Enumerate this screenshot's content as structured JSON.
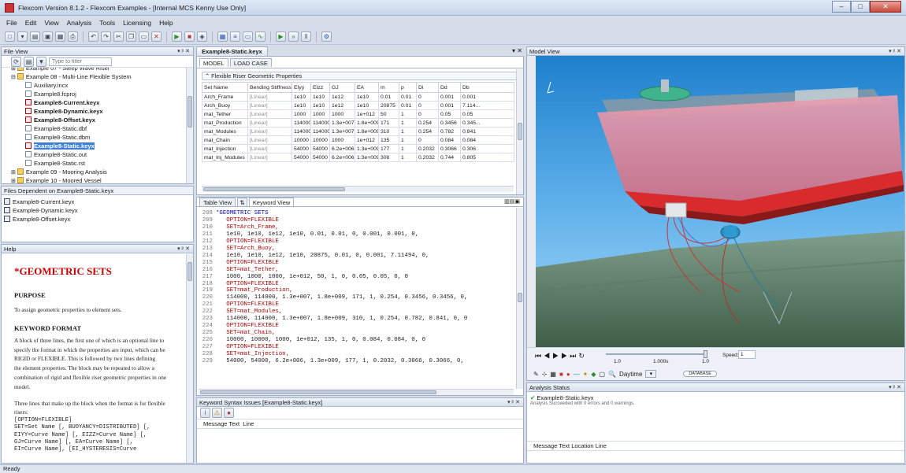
{
  "window": {
    "title": "Flexcom Version 8.1.2 - Flexcom Examples - [Internal MCS Kenny Use Only]",
    "minimize": "–",
    "maximize": "□",
    "close": "✕"
  },
  "menu": [
    "File",
    "Edit",
    "View",
    "Analysis",
    "Tools",
    "Licensing",
    "Help"
  ],
  "toolbar_icons": [
    "new-icon",
    "open-icon",
    "folder-icon",
    "save-icon",
    "save-all-icon",
    "print-icon",
    "undo-icon",
    "redo-icon",
    "cut-icon",
    "copy-icon",
    "paste-icon",
    "delete-icon",
    "run-icon",
    "stop-icon",
    "view-icon",
    "table-view-icon",
    "keyword-view-icon",
    "model-view-icon",
    "chart-icon",
    "play-icon",
    "fast-forward-icon",
    "pause-icon",
    "settings-icon"
  ],
  "file_view": {
    "title": "File View",
    "filter_placeholder": "Type to filter",
    "items": [
      {
        "label": "Example 07 - Steep Wave Riser",
        "indent": 1,
        "icon": "folder",
        "bold": false
      },
      {
        "label": "Example 08 - Multi-Line Flexible System",
        "indent": 1,
        "icon": "folder",
        "bold": false
      },
      {
        "label": "Auxiliary.incx",
        "indent": 2,
        "icon": "file",
        "bold": false
      },
      {
        "label": "Example8.fcproj",
        "indent": 2,
        "icon": "file",
        "bold": false
      },
      {
        "label": "Example8-Current.keyx",
        "indent": 2,
        "icon": "key",
        "bold": true
      },
      {
        "label": "Example8-Dynamic.keyx",
        "indent": 2,
        "icon": "key",
        "bold": true
      },
      {
        "label": "Example8-Offset.keyx",
        "indent": 2,
        "icon": "key",
        "bold": true
      },
      {
        "label": "Example8-Static.dbf",
        "indent": 2,
        "icon": "file",
        "bold": false
      },
      {
        "label": "Example8-Static.dbm",
        "indent": 2,
        "icon": "file",
        "bold": false
      },
      {
        "label": "Example8-Static.keyx",
        "indent": 2,
        "icon": "key",
        "bold": true,
        "selected": true
      },
      {
        "label": "Example8-Static.out",
        "indent": 2,
        "icon": "file",
        "bold": false
      },
      {
        "label": "Example8-Static.rst",
        "indent": 2,
        "icon": "file",
        "bold": false
      },
      {
        "label": "Example 09 - Mooring Analysis",
        "indent": 1,
        "icon": "folder",
        "bold": false
      },
      {
        "label": "Example 10 - Moored Vessel",
        "indent": 1,
        "icon": "folder",
        "bold": false
      }
    ]
  },
  "dependents": {
    "title": "Files Dependent on Example8-Static.keyx",
    "items": [
      "Example8-Current.keyx",
      "Example8-Dynamic.keyx",
      "Example8-Offset.keyx"
    ]
  },
  "help": {
    "title": "Help",
    "heading": "*GEOMETRIC SETS",
    "purpose_h": "PURPOSE",
    "purpose": "To assign geometric properties to element sets.",
    "format_h": "KEYWORD FORMAT",
    "format_lines": [
      "A block of three lines, the first one of which is an optional line to",
      "specify the format in which the properties are input, which can be",
      "RIGID or FLEXIBLE. This is followed by two lines defining",
      "the element properties. The block may be repeated to allow a",
      "combination of rigid and flexible riser geometric properties in one",
      "model."
    ],
    "flex_lines": [
      "Three lines that make up the block when the format is for flexible",
      "risers:"
    ],
    "mono_lines": [
      "[OPTION=FLEXIBLE]",
      "SET=Set Name [, BUOYANCY=DISTRIBUTED] [,",
      "EIYY=Curve Name] [, EIZZ=Curve Name] [,",
      "GJ=Curve Name] [, EA=Curve Name] [,",
      "EI=Curve Name], [EI_HYSTERESIS=Curve"
    ]
  },
  "editor": {
    "doc_tab": "Example8-Static.keyx",
    "tabs": [
      "MODEL",
      "LOAD CASE"
    ],
    "section_title": "Flexible Riser Geometric Properties",
    "columns": [
      "Set Name",
      "Bending Stiffness",
      "EIyy",
      "EIzz",
      "GJ",
      "EA",
      "m",
      "p",
      "Di",
      "Dd",
      "Db"
    ],
    "rows": [
      [
        "Arch_Frame",
        "[Linear]",
        "1e10",
        "1e10",
        "1e12",
        "1e10",
        "0.01",
        "0.01",
        "0",
        "0.001",
        "0.001"
      ],
      [
        "Arch_Buoy",
        "[Linear]",
        "1e10",
        "1e10",
        "1e12",
        "1e10",
        "20875",
        "0.01",
        "0",
        "0.001",
        "7.114..."
      ],
      [
        "mat_Tether",
        "[Linear]",
        "1000",
        "1000",
        "1000",
        "1e+012",
        "50",
        "1",
        "0",
        "0.05",
        "0.05"
      ],
      [
        "mat_Production",
        "[Linear]",
        "114000",
        "114000",
        "1.3e+007",
        "1.8e+009",
        "171",
        "1",
        "0.254",
        "0.3456",
        "0.345..."
      ],
      [
        "mat_Modules",
        "[Linear]",
        "114000",
        "114000",
        "1.3e+007",
        "1.8e+009",
        "310",
        "1",
        "0.254",
        "0.782",
        "0.841"
      ],
      [
        "mat_Chain",
        "[Linear]",
        "10000",
        "10000",
        "1000",
        "1e+012",
        "135",
        "1",
        "0",
        "0.084",
        "0.084"
      ],
      [
        "mat_Injection",
        "[Linear]",
        "54000",
        "54000",
        "6.2e+006",
        "1.3e+009",
        "177",
        "1",
        "0.2032",
        "0.3066",
        "0.306"
      ],
      [
        "mat_Inj_Modules",
        "[Linear]",
        "54000",
        "54000",
        "6.2e+006",
        "1.3e+009",
        "308",
        "1",
        "0.2032",
        "0.744",
        "0.805"
      ]
    ],
    "view_tabs": [
      "Table View",
      "Keyword View"
    ],
    "code_lines": [
      {
        "n": "208",
        "t": "*GEOMETRIC SETS",
        "cls": "blue"
      },
      {
        "n": "209",
        "t": "   OPTION=FLEXIBLE",
        "cls": "kw"
      },
      {
        "n": "210",
        "t": "   SET=Arch_Frame,",
        "cls": "kw"
      },
      {
        "n": "211",
        "t": "   1e10, 1e10, 1e12, 1e10, 0.01, 0.01, 0, 0.001, 0.001, 0,",
        "cls": ""
      },
      {
        "n": "212",
        "t": "   OPTION=FLEXIBLE",
        "cls": "kw"
      },
      {
        "n": "213",
        "t": "   SET=Arch_Buoy,",
        "cls": "kw"
      },
      {
        "n": "214",
        "t": "   1e10, 1e10, 1e12, 1e10, 20875, 0.01, 0, 0.001, 7.11494, 0,",
        "cls": ""
      },
      {
        "n": "215",
        "t": "   OPTION=FLEXIBLE",
        "cls": "kw"
      },
      {
        "n": "216",
        "t": "   SET=mat_Tether,",
        "cls": "kw"
      },
      {
        "n": "217",
        "t": "   1000, 1000, 1000, 1e+012, 50, 1, 0, 0.05, 0.05, 0, 0",
        "cls": ""
      },
      {
        "n": "218",
        "t": "   OPTION=FLEXIBLE",
        "cls": "kw"
      },
      {
        "n": "219",
        "t": "   SET=mat_Production,",
        "cls": "kw"
      },
      {
        "n": "220",
        "t": "   114000, 114000, 1.3e+007, 1.8e+009, 171, 1, 0.254, 0.3456, 0.3456, 0,",
        "cls": ""
      },
      {
        "n": "221",
        "t": "   OPTION=FLEXIBLE",
        "cls": "kw"
      },
      {
        "n": "222",
        "t": "   SET=mat_Modules,",
        "cls": "kw"
      },
      {
        "n": "223",
        "t": "   114000, 114000, 1.3e+007, 1.8e+009, 310, 1, 0.254, 0.782, 0.841, 0, 0",
        "cls": ""
      },
      {
        "n": "224",
        "t": "   OPTION=FLEXIBLE",
        "cls": "kw"
      },
      {
        "n": "225",
        "t": "   SET=mat_Chain,",
        "cls": "kw"
      },
      {
        "n": "226",
        "t": "   10000, 10000, 1000, 1e+012, 135, 1, 0, 0.084, 0.084, 0, 0",
        "cls": ""
      },
      {
        "n": "227",
        "t": "   OPTION=FLEXIBLE",
        "cls": "kw"
      },
      {
        "n": "228",
        "t": "   SET=mat_Injection,",
        "cls": "kw"
      },
      {
        "n": "229",
        "t": "   54000, 54000, 6.2e+006, 1.3e+009, 177, 1, 0.2032, 0.3066, 0.3066, 0,",
        "cls": ""
      }
    ]
  },
  "syntax": {
    "title": "Keyword Syntax Issues [Example8-Static.keyx]",
    "columns": [
      "Message Text",
      "Line"
    ]
  },
  "model_view": {
    "title": "Model View",
    "time_start": "1.0",
    "time_mid": "1.000s",
    "time_end": "1.0",
    "speed_label": "Speed:",
    "speed_value": "1",
    "daytime": "Daytime",
    "database_btn": "DATABASE"
  },
  "analysis_status": {
    "title": "Analysis Status",
    "file": "Example8-Static.keyx",
    "message": "Analysis Succeeded with 0 errors and 0 warnings.",
    "columns": [
      "Message Text",
      "Location",
      "Line"
    ]
  },
  "status": "Ready"
}
